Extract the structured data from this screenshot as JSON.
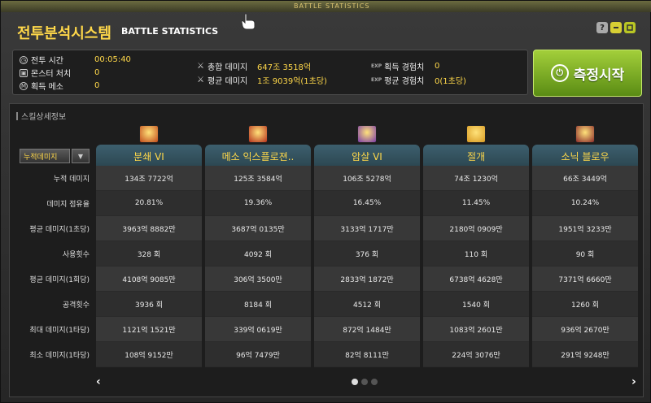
{
  "topstrip": {
    "label": "BATTLE STATISTICS"
  },
  "window": {
    "title_ko": "전투분석시스템",
    "title_en": "BATTLE STATISTICS",
    "help": "?",
    "minimize": "",
    "close": ""
  },
  "summary": {
    "battle_time_label": "전투 시간",
    "battle_time_value": "00:05:40",
    "monster_kills_label": "몬스터 처치",
    "monster_kills_value": "0",
    "mesos_label": "획득 메소",
    "mesos_value": "0",
    "total_damage_label": "총합 데미지",
    "total_damage_value": "647조 3518억",
    "avg_damage_label": "평균 데미지",
    "avg_damage_value": "1조 9039억(1초당)",
    "exp_label": "획득 경험치",
    "exp_value": "0",
    "avg_exp_label": "평균 경험치",
    "avg_exp_value": "0(1초당)",
    "exp_tag": "EXP"
  },
  "measure_button": {
    "label": "측정시작"
  },
  "detail": {
    "title": "스킬상세정보",
    "filter_value": "누적데미지",
    "row_labels": [
      "누적 데미지",
      "데미지 점유율",
      "평균 데미지(1초당)",
      "사용횟수",
      "평균 데미지(1회당)",
      "공격횟수",
      "최대 데미지(1타당)",
      "최소 데미지(1타당)"
    ],
    "skills": [
      {
        "name": "분쇄 VI",
        "icon_color": "#c04a1a",
        "values": [
          "134조 7722억",
          "20.81%",
          "3963억 8882만",
          "328 회",
          "4108억 9085만",
          "3936 회",
          "1121억 1521만",
          "108억 9152만"
        ]
      },
      {
        "name": "메소 익스플로젼..",
        "icon_color": "#b5301c",
        "values": [
          "125조 3584억",
          "19.36%",
          "3687억 0135만",
          "4092 회",
          "306억 3500만",
          "8184 회",
          "339억 0619만",
          "96억 7479만"
        ]
      },
      {
        "name": "암살 VI",
        "icon_color": "#7a3aa8",
        "values": [
          "106조 5278억",
          "16.45%",
          "3133억 1717만",
          "376 회",
          "2833억 1872만",
          "4512 회",
          "872억 1484만",
          "82억 8111만"
        ]
      },
      {
        "name": "절개",
        "icon_color": "#d89a22",
        "values": [
          "74조 1230억",
          "11.45%",
          "2180억 0909만",
          "110 회",
          "6738억 4628만",
          "1540 회",
          "1083억 2601만",
          "224억 3076만"
        ]
      },
      {
        "name": "소닉 블로우",
        "icon_color": "#8a2a2a",
        "values": [
          "66조 3449억",
          "10.24%",
          "1951억 3233만",
          "90 회",
          "7371억 6660만",
          "1260 회",
          "936억 2670만",
          "291억 9248만"
        ]
      }
    ],
    "prev": "‹",
    "next": "›"
  }
}
